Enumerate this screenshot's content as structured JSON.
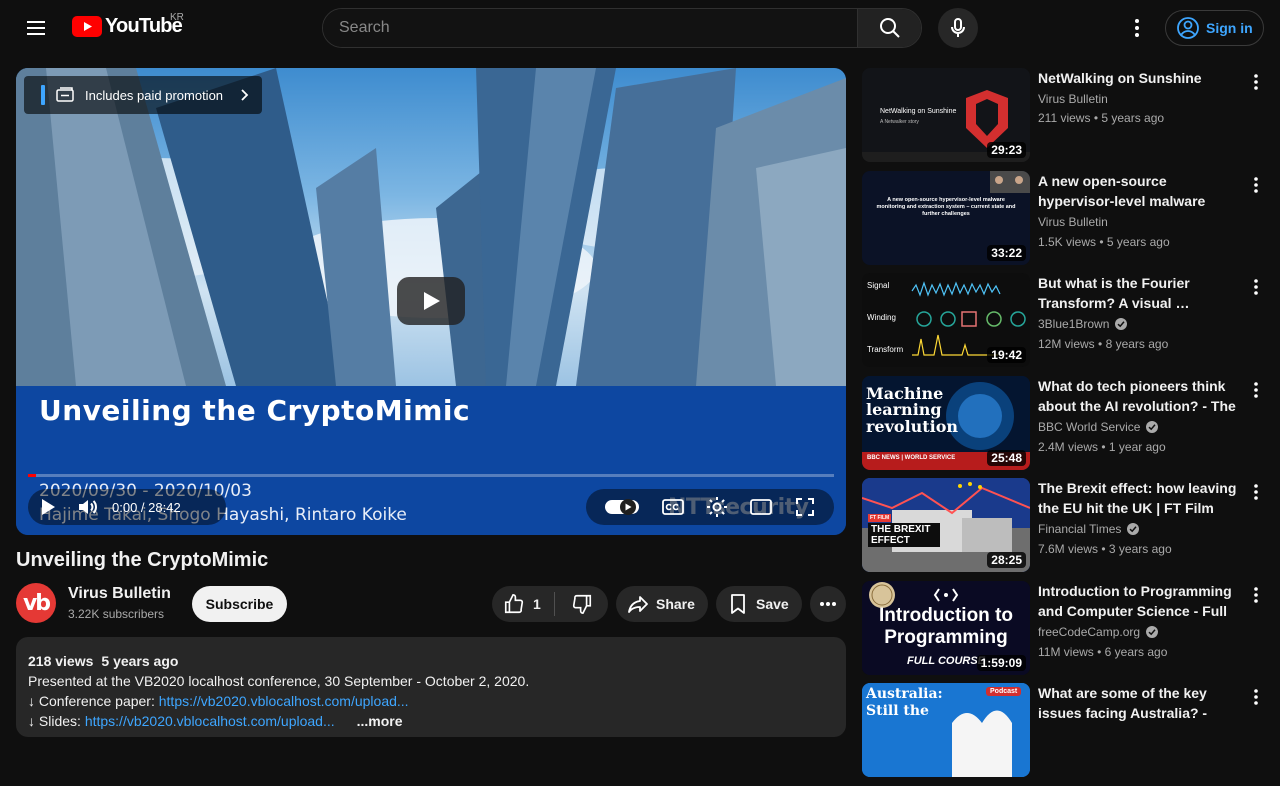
{
  "header": {
    "logo_text": "YouTube",
    "country_code": "KR",
    "search_placeholder": "Search",
    "signin_label": "Sign in"
  },
  "player": {
    "promo_label": "Includes paid promotion",
    "overlay_title": "Unveiling the CryptoMimic",
    "overlay_date": "2020/09/30 - 2020/10/03",
    "overlay_authors": "Hajime Takai, Shogo Hayashi, Rintaro Koike",
    "time_display": "0:00 / 28:42",
    "watermark": "NTTsecurity",
    "progress": 0
  },
  "video": {
    "title": "Unveiling the CryptoMimic",
    "channel_avatar_text": "vb",
    "channel_name": "Virus Bulletin",
    "channel_subs": "3.22K subscribers",
    "subscribe_label": "Subscribe",
    "like_count": "1",
    "share_label": "Share",
    "save_label": "Save"
  },
  "description": {
    "views": "218 views",
    "age": "5 years ago",
    "line1": "Presented at the VB2020 localhost conference, 30 September - October 2, 2020.",
    "paper_prefix": "↓ Conference paper: ",
    "paper_link": "https://vb2020.vblocalhost.com/upload...",
    "slides_prefix": "↓ Slides: ",
    "slides_link": "https://vb2020.vblocalhost.com/upload...",
    "more_label": "...more"
  },
  "recommendations": [
    {
      "title": "NetWalking on Sunshine",
      "channel": "Virus Bulletin",
      "verified": false,
      "views": "211 views",
      "age": "5 years ago",
      "duration": "29:23",
      "thumb_text": "NetWalking on Sunshine",
      "thumb_sub": "A Netwalker story"
    },
    {
      "title": "A new open-source hypervisor-level malware monitoring and …",
      "channel": "Virus Bulletin",
      "verified": false,
      "views": "1.5K views",
      "age": "5 years ago",
      "duration": "33:22",
      "thumb_text": "A new open-source hypervisor-level malware monitoring and extraction system – current state and further challenges"
    },
    {
      "title": "But what is the Fourier Transform?  A visual …",
      "channel": "3Blue1Brown",
      "verified": true,
      "views": "12M views",
      "age": "8 years ago",
      "duration": "19:42",
      "thumb_labels": [
        "Signal",
        "Winding",
        "Transform"
      ]
    },
    {
      "title": "What do tech pioneers think about the AI revolution? - The …",
      "channel": "BBC World Service",
      "verified": true,
      "views": "2.4M views",
      "age": "1 year ago",
      "duration": "25:48",
      "thumb_text": "Machine learning revolution",
      "thumb_sub": "BBC NEWS | WORLD SERVICE"
    },
    {
      "title": "The Brexit effect: how leaving the EU hit the UK | FT Film",
      "channel": "Financial Times",
      "verified": true,
      "views": "7.6M views",
      "age": "3 years ago",
      "duration": "28:25",
      "thumb_text": "THE BREXIT EFFECT",
      "thumb_sub": "FT FILM"
    },
    {
      "title": "Introduction to Programming and Computer Science - Full …",
      "channel": "freeCodeCamp.org",
      "verified": true,
      "views": "11M views",
      "age": "6 years ago",
      "duration": "1:59:09",
      "thumb_text": "Introduction to Programming",
      "thumb_sub": "FULL COURSE"
    },
    {
      "title": "What are some of the key issues facing Australia? - Worl…",
      "channel": "",
      "verified": false,
      "views": "",
      "age": "",
      "duration": "",
      "thumb_text": "Australia: Still the",
      "thumb_sub": "Podcast"
    }
  ]
}
